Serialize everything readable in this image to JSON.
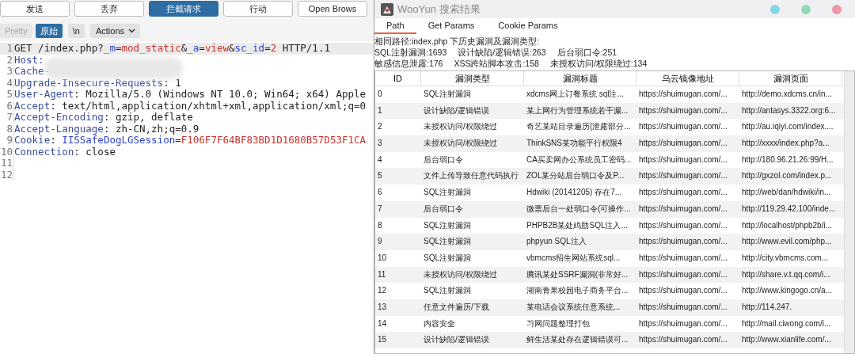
{
  "toolbar": {
    "buttons": [
      {
        "label": "发送",
        "selected": false
      },
      {
        "label": "丢弃",
        "selected": false
      },
      {
        "label": "拦截请求",
        "selected": true
      },
      {
        "label": "行动",
        "selected": false
      },
      {
        "label": "Open Brows",
        "selected": false
      }
    ]
  },
  "view_tabs": [
    {
      "label": "Pretty",
      "selected": false
    },
    {
      "label": "原始",
      "selected": true
    }
  ],
  "newline_toggle": "\\n",
  "actions_menu": {
    "label": "Actions"
  },
  "editor": {
    "redacted": true,
    "lines": [
      {
        "number": "1",
        "tokens": [
          {
            "kind": "plain",
            "text": "GET /index.php?"
          },
          {
            "kind": "param",
            "text": "_m"
          },
          {
            "kind": "plain",
            "text": "="
          },
          {
            "kind": "value",
            "text": "mod_static"
          },
          {
            "kind": "plain",
            "text": "&"
          },
          {
            "kind": "param",
            "text": "_a"
          },
          {
            "kind": "plain",
            "text": "="
          },
          {
            "kind": "value",
            "text": "view"
          },
          {
            "kind": "plain",
            "text": "&"
          },
          {
            "kind": "param",
            "text": "sc_id"
          },
          {
            "kind": "plain",
            "text": "="
          },
          {
            "kind": "value",
            "text": "2"
          },
          {
            "kind": "plain",
            "text": " HTTP/1.1"
          }
        ]
      },
      {
        "number": "2",
        "tokens": [
          {
            "kind": "key",
            "text": "Host:"
          }
        ]
      },
      {
        "number": "3",
        "tokens": [
          {
            "kind": "key",
            "text": "Cache-"
          }
        ]
      },
      {
        "number": "4",
        "tokens": [
          {
            "kind": "key",
            "text": "Upgrade-Insecure-Requests"
          },
          {
            "kind": "plain",
            "text": ": 1"
          }
        ]
      },
      {
        "number": "5",
        "tokens": [
          {
            "kind": "key",
            "text": "User-Agent"
          },
          {
            "kind": "plain",
            "text": ": Mozilla/5.0 (Windows NT 10.0; Win64; x64) Apple"
          }
        ]
      },
      {
        "number": "6",
        "tokens": [
          {
            "kind": "key",
            "text": "Accept"
          },
          {
            "kind": "plain",
            "text": ": text/html,application/xhtml+xml,application/xml;q=0"
          }
        ]
      },
      {
        "number": "7",
        "tokens": [
          {
            "kind": "key",
            "text": "Accept-Encoding"
          },
          {
            "kind": "plain",
            "text": ": gzip, deflate"
          }
        ]
      },
      {
        "number": "8",
        "tokens": [
          {
            "kind": "key",
            "text": "Accept-Language"
          },
          {
            "kind": "plain",
            "text": ": zh-CN,zh;q=0.9"
          }
        ]
      },
      {
        "number": "9",
        "tokens": [
          {
            "kind": "key",
            "text": "Cookie"
          },
          {
            "kind": "plain",
            "text": ": "
          },
          {
            "kind": "param",
            "text": "IISSafeDogLGSession"
          },
          {
            "kind": "plain",
            "text": "="
          },
          {
            "kind": "value",
            "text": "F106F7F64BF83BD1D1680B57D53F1CA"
          }
        ]
      },
      {
        "number": "10",
        "tokens": [
          {
            "kind": "key",
            "text": "Connection"
          },
          {
            "kind": "plain",
            "text": ": close"
          }
        ]
      },
      {
        "number": "11"
      },
      {
        "number": "12"
      }
    ]
  },
  "window": {
    "title": "WooYun 搜索结果",
    "tabs": [
      {
        "label": "Path",
        "selected": true
      },
      {
        "label": "Get Params",
        "selected": false
      },
      {
        "label": "Cookie Params",
        "selected": false
      }
    ],
    "summary": [
      "相同路径:index.php 下历史漏洞及漏洞类型:",
      [
        "SQL注射漏洞:1693",
        "设计缺陷/逻辑错误:263",
        "后台弱口令:251"
      ],
      [
        "敏感信息泄露:176",
        "XSS跨站脚本攻击:158",
        "未授权访问/权限绕过:134"
      ]
    ],
    "table": {
      "columns": [
        "ID",
        "漏洞类型",
        "漏洞标题",
        "乌云镜像地址",
        "漏洞页面"
      ],
      "rows": [
        [
          "0",
          "SQL注射漏洞",
          "xdcms网上订餐系统 sql注...",
          "https://shuimugan.com/...",
          "http://demo.xdcms.cn/in..."
        ],
        [
          "1",
          "设计缺陷/逻辑错误",
          "某上网行为管理系统若干漏...",
          "https://shuimugan.com/...",
          "http://antasys.3322.org:6..."
        ],
        [
          "2",
          "未授权访问/权限绕过",
          "奇艺某站目录遍历(泄露部分...",
          "https://shuimugan.com/...",
          "http://au.iqiyi.com/index...."
        ],
        [
          "3",
          "未授权访问/权限绕过",
          "ThinkSNS某功能平行权限4",
          "https://shuimugan.com/...",
          "http://xxxx/index.php?a..."
        ],
        [
          "4",
          "后台弱口令",
          "CA买卖网办公系统员工密码...",
          "https://shuimugan.com/...",
          "http://180.96.21.26:99/H..."
        ],
        [
          "5",
          "文件上传导致任意代码执行",
          "ZOL某分站后台弱口令及P...",
          "https://shuimugan.com/...",
          "http://gxzol.com/index.p..."
        ],
        [
          "6",
          "SQL注射漏洞",
          "Hdwiki (20141205) 存在7...",
          "https://shuimugan.com/...",
          "http://web/dan/hdwiki/in..."
        ],
        [
          "7",
          "后台弱口令",
          "微票后台一处弱口令(可操作...",
          "https://shuimugan.com/...",
          "http://119.29.42.100/inde..."
        ],
        [
          "8",
          "SQL注射漏洞",
          "PHPB2B某处鸡肋SQL注入...",
          "https://shuimugan.com/...",
          "http://localhost/phpb2b/i..."
        ],
        [
          "9",
          "SQL注射漏洞",
          "phpyun SQL注入",
          "https://shuimugan.com/...",
          "http://www.evil.com/php..."
        ],
        [
          "10",
          "SQL注射漏洞",
          "vbmcms招生网站系统sql...",
          "https://shuimugan.com/...",
          "http://city.vbmcms.com..."
        ],
        [
          "11",
          "未授权访问/权限绕过",
          "腾讯某处SSRF漏洞(非常好...",
          "https://shuimugan.com/...",
          "http://share.v.t.qq.com/i..."
        ],
        [
          "12",
          "SQL注射漏洞",
          "湖南青果校园电子商务平台...",
          "https://shuimugan.com/...",
          "http://www.kingogo.cn/a..."
        ],
        [
          "13",
          "任意文件遍历/下载",
          "某电话会议系统任意系统...",
          "https://shuimugan.com/...",
          "http://114.247."
        ],
        [
          "14",
          "内容安全",
          "习网问题整理打包",
          "https://shuimugan.com/...",
          "http://mail.ciwong.com/i..."
        ],
        [
          "15",
          "设计缺陷/逻辑错误",
          "鲜生活某处存在逻辑错误可...",
          "https://shuimugan.com/...",
          "http://www.xianlife.com/..."
        ]
      ]
    }
  }
}
